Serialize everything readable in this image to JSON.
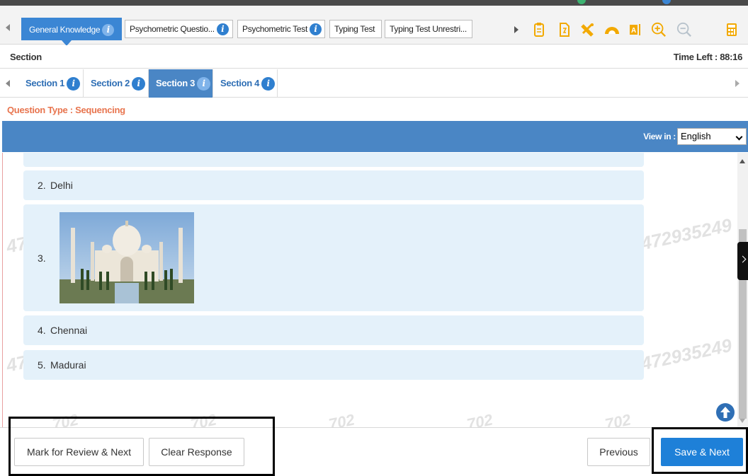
{
  "colors": {
    "accent": "#3b86d4",
    "blue_bar": "#4a86c5",
    "question_type": "#e8754f",
    "option_bg": "#e4f1fa",
    "save_button": "#1e80d8"
  },
  "test_tabs": [
    {
      "label": "General Knowledge",
      "active": true,
      "has_info": true
    },
    {
      "label": "Psychometric Questio...",
      "active": false,
      "has_info": true
    },
    {
      "label": "Psychometric Test",
      "active": false,
      "has_info": true
    },
    {
      "label": "Typing Test",
      "active": false,
      "has_info": false
    },
    {
      "label": "Typing Test Unrestri...",
      "active": false,
      "has_info": false
    }
  ],
  "info_glyph": "i",
  "toolbar_icons": [
    "notepad-icon",
    "rough-sheet-icon",
    "scale-icon",
    "protractor-icon",
    "text-size-icon",
    "zoom-in-icon",
    "zoom-out-icon",
    "calculator-icon"
  ],
  "section_label": "Section",
  "time_left": "Time Left : 88:16",
  "section_tabs": [
    {
      "label": "Section 1",
      "active": false
    },
    {
      "label": "Section 2",
      "active": false
    },
    {
      "label": "Section 3",
      "active": true
    },
    {
      "label": "Section 4",
      "active": false
    }
  ],
  "question_type": "Question Type : Sequencing",
  "view_in_label": "View in :",
  "language_selected": "English",
  "options": [
    {
      "number": "2.",
      "text": "Delhi"
    },
    {
      "number": "3.",
      "text": "",
      "image": "taj-mahal-photo"
    },
    {
      "number": "4.",
      "text": "Chennai"
    },
    {
      "number": "5.",
      "text": "Madurai"
    }
  ],
  "watermark": "472935249",
  "footer": {
    "mark_review": "Mark for Review & Next",
    "clear_response": "Clear Response",
    "previous": "Previous",
    "save_next": "Save & Next"
  }
}
